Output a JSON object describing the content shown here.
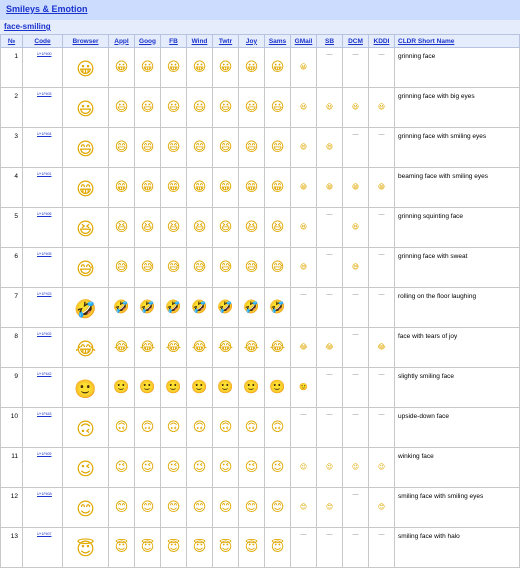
{
  "header": {
    "title": "Smileys & Emotion",
    "subgroup": "face-smiling"
  },
  "columns": {
    "num": "№",
    "code": "Code",
    "browser": "Browser",
    "appl": "Appl",
    "goog": "Goog",
    "fb": "FB",
    "wind": "Wind",
    "twtr": "Twtr",
    "joy": "Joy",
    "sams": "Sams",
    "gmail": "GMail",
    "sb": "SB",
    "dcm": "DCM",
    "kddi": "KDDI",
    "cldr": "CLDR Short Name"
  },
  "dash": "—",
  "rows": [
    {
      "num": "1",
      "code": "U+1F600",
      "glyph": "😀",
      "gmail": "😀",
      "sb": "—",
      "dcm": "—",
      "kddi": "—",
      "name": "grinning face"
    },
    {
      "num": "2",
      "code": "U+1F603",
      "glyph": "😃",
      "gmail": "😃",
      "sb": "😃",
      "dcm": "😃",
      "kddi": "😃",
      "name": "grinning face with big eyes"
    },
    {
      "num": "3",
      "code": "U+1F604",
      "glyph": "😄",
      "gmail": "😄",
      "sb": "😄",
      "dcm": "—",
      "kddi": "—",
      "name": "grinning face with smiling eyes"
    },
    {
      "num": "4",
      "code": "U+1F601",
      "glyph": "😁",
      "gmail": "😁",
      "sb": "😁",
      "dcm": "😁",
      "kddi": "😁",
      "name": "beaming face with smiling eyes"
    },
    {
      "num": "5",
      "code": "U+1F606",
      "glyph": "😆",
      "gmail": "😆",
      "sb": "—",
      "dcm": "😆",
      "kddi": "—",
      "name": "grinning squinting face"
    },
    {
      "num": "6",
      "code": "U+1F605",
      "glyph": "😅",
      "gmail": "😅",
      "sb": "—",
      "dcm": "😅",
      "kddi": "—",
      "name": "grinning face with sweat"
    },
    {
      "num": "7",
      "code": "U+1F923",
      "glyph": "🤣",
      "gmail": "—",
      "sb": "—",
      "dcm": "—",
      "kddi": "—",
      "name": "rolling on the floor laughing"
    },
    {
      "num": "8",
      "code": "U+1F602",
      "glyph": "😂",
      "gmail": "😂",
      "sb": "😂",
      "dcm": "—",
      "kddi": "😂",
      "name": "face with tears of joy"
    },
    {
      "num": "9",
      "code": "U+1F642",
      "glyph": "🙂",
      "gmail": "🙂",
      "sb": "—",
      "dcm": "—",
      "kddi": "—",
      "name": "slightly smiling face"
    },
    {
      "num": "10",
      "code": "U+1F643",
      "glyph": "🙃",
      "gmail": "—",
      "sb": "—",
      "dcm": "—",
      "kddi": "—",
      "name": "upside-down face"
    },
    {
      "num": "11",
      "code": "U+1F609",
      "glyph": "😉",
      "gmail": "😉",
      "sb": "😉",
      "dcm": "😉",
      "kddi": "😉",
      "name": "winking face"
    },
    {
      "num": "12",
      "code": "U+1F60A",
      "glyph": "😊",
      "gmail": "😊",
      "sb": "😊",
      "dcm": "—",
      "kddi": "😊",
      "name": "smiling face with smiling eyes"
    },
    {
      "num": "13",
      "code": "U+1F607",
      "glyph": "😇",
      "gmail": "—",
      "sb": "—",
      "dcm": "—",
      "kddi": "—",
      "name": "smiling face with halo"
    }
  ]
}
